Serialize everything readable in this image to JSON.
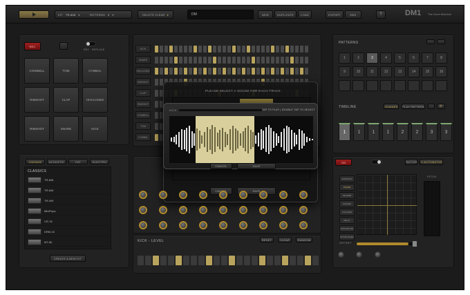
{
  "topbar": {
    "play_icon": "play-icon",
    "kit_label": "KIT",
    "kit_value": "TR-808",
    "patterns_label": "PATTERNS",
    "patterns_value": "8",
    "delete_clear": "DELETE CLEAR",
    "display": "DM",
    "new": "NEW",
    "duplicate": "DUPLICATE",
    "load": "LOAD",
    "export": "EXPORT",
    "midi": "MIDI",
    "help": "?",
    "logo": "DM1",
    "logo_sub": "The Drum Machine"
  },
  "pads": {
    "rec": "REC",
    "toggle_left": "REC",
    "toggle_right": "REPLACE",
    "items": [
      "COWBELL",
      "TOM",
      "CYMBAL",
      "RIMSHOT",
      "CLAP",
      "HHCLOSED",
      "RIMSHOT",
      "SNARE",
      "KICK"
    ]
  },
  "sequencer": {
    "tracks": [
      "KICK",
      "SNARE",
      "HHCLOSED",
      "RIMSHOT",
      "CLAP",
      "RIMSHOT",
      "COWBELL",
      "TOM",
      "CYMBAL"
    ]
  },
  "kits": {
    "tabs": [
      "VINTAGE",
      "ACOUSTIC",
      "FAT",
      "ELECTRO"
    ],
    "header": "CLASSICS",
    "items": [
      "TR-808",
      "TR-606",
      "TR-909",
      "MiniPops",
      "CR-78",
      "DRM-15",
      "MT-80"
    ],
    "create": "CREATE A NEW KIT"
  },
  "patterns": {
    "title": "PATTERNS",
    "numbers": [
      "1",
      "2",
      "3",
      "4",
      "5",
      "6",
      "7",
      "8",
      "9",
      "10",
      "11",
      "12",
      "13",
      "14",
      "15",
      "16",
      "",
      "",
      "",
      "",
      "",
      "",
      "",
      ""
    ],
    "timeline_title": "TIMELINE",
    "timeline_chain": "CHAINED",
    "timeline_btn": "PLAY PATTERN",
    "timeline": [
      "1",
      "1",
      "1",
      "1",
      "2",
      "2",
      "3",
      "3"
    ]
  },
  "fx": {
    "power": "ON",
    "mode_a": "FACTOR",
    "mode_b": "FX AUTOMATION",
    "items": [
      "SAMPLING",
      "FILTER",
      "REVERB",
      "PHASER",
      "FLANGER",
      "DELAY",
      "DISTORTION",
      "BITCRUSHER"
    ],
    "pitch": "PITCH",
    "offset": "OFFSET"
  },
  "level": {
    "title": "KICK - LEVEL",
    "b1": "RESET",
    "b2": "CLEAR",
    "b3": "RANDOM"
  },
  "dialog_back": {
    "title": "PLEASE SELECT A SOUND FOR EACH TRACK",
    "cancel": "CANCEL",
    "save": "SAVE"
  },
  "dialog": {
    "name": "KICK",
    "hint": "TAP TO PLAY | DOUBLE TAP TO SELECT",
    "cancel": "CANCEL",
    "save": "SAVE"
  }
}
